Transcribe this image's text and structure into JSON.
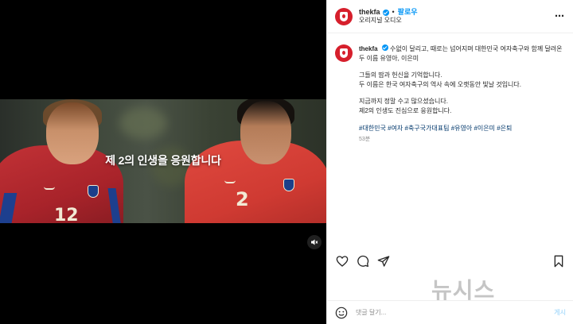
{
  "video": {
    "caption": "제 2의 인생을 응원합니다",
    "jersey_left": "12",
    "jersey_right": "2",
    "mute_icon": "speaker-muted-icon"
  },
  "header": {
    "username": "thekfa",
    "separator": "•",
    "follow_label": "팔로우",
    "audio_label": "오리지널 오디오",
    "more_label": "⋯"
  },
  "post": {
    "username": "thekfa",
    "caption_line1": "수없이 달리고, 때로는 넘어지며 대한민국 여자축구와 함께 달려온 두 이름 유영아, 이은미",
    "caption_line2": "그들의 땀과 헌신을 기억합니다.",
    "caption_line3": "두 이름은 한국 여자축구의 역사 속에 오랫동안 빛날 것입니다.",
    "caption_line4": "지금까지 정말 수고 많으셨습니다.",
    "caption_line5": "제2의 인생도 진심으로 응원합니다.",
    "hashtags": "#대한민국 #여자 #축구국가대표팀 #유영아 #이은미 #은퇴",
    "time": "53분"
  },
  "actions": {
    "like_icon": "heart-icon",
    "comment_icon": "comment-icon",
    "share_icon": "share-icon",
    "save_icon": "bookmark-icon"
  },
  "watermark": "뉴시스",
  "comment": {
    "placeholder": "댓글 달기...",
    "post_label": "게시"
  },
  "colors": {
    "brand_red": "#d61f2c",
    "link_blue": "#0095f6",
    "hashtag_blue": "#00376b"
  }
}
